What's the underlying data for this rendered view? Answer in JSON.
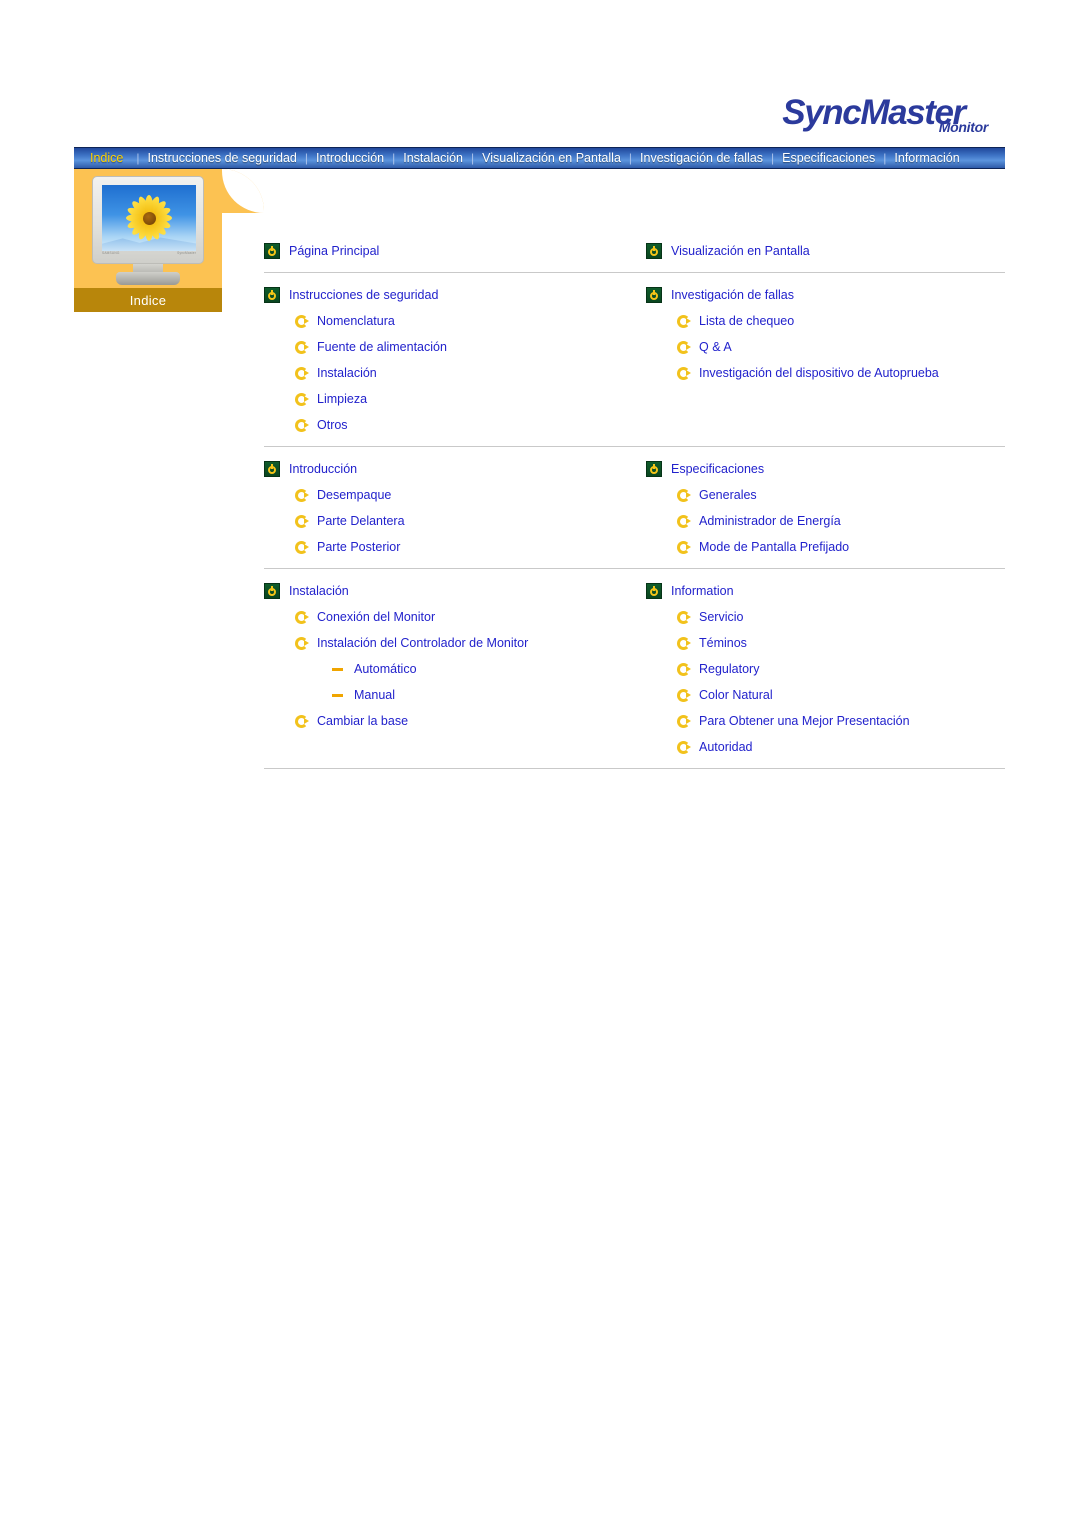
{
  "brand": {
    "name": "SyncMaster",
    "sub": "Monitor"
  },
  "nav": {
    "items": [
      {
        "label": "Indice",
        "active": true
      },
      {
        "label": "Instrucciones de seguridad",
        "active": false
      },
      {
        "label": "Introducción",
        "active": false
      },
      {
        "label": "Instalación",
        "active": false
      },
      {
        "label": "Visualización en Pantalla",
        "active": false
      },
      {
        "label": "Investigación de fallas",
        "active": false
      },
      {
        "label": "Especificaciones",
        "active": false
      },
      {
        "label": "Información",
        "active": false
      }
    ],
    "separator": "|"
  },
  "sidebar": {
    "label": "Indice",
    "image": {
      "icon": "monitor-sunflower-image",
      "brand_mark": "SAMSUNG",
      "model_mark": "SyncMaster"
    }
  },
  "content": {
    "groups": [
      {
        "left": {
          "items": [
            {
              "label": "Página Principal",
              "level": 1,
              "icon": "power-icon"
            }
          ]
        },
        "right": {
          "items": [
            {
              "label": "Visualización en Pantalla",
              "level": 1,
              "icon": "power-icon"
            }
          ]
        }
      },
      {
        "left": {
          "items": [
            {
              "label": "Instrucciones de seguridad",
              "level": 1,
              "icon": "power-icon"
            },
            {
              "label": "Nomenclatura",
              "level": 2,
              "icon": "circle-arrow-icon"
            },
            {
              "label": "Fuente de alimentación",
              "level": 2,
              "icon": "circle-arrow-icon"
            },
            {
              "label": "Instalación",
              "level": 2,
              "icon": "circle-arrow-icon"
            },
            {
              "label": "Limpieza",
              "level": 2,
              "icon": "circle-arrow-icon"
            },
            {
              "label": "Otros",
              "level": 2,
              "icon": "circle-arrow-icon"
            }
          ]
        },
        "right": {
          "items": [
            {
              "label": "Investigación de fallas",
              "level": 1,
              "icon": "power-icon"
            },
            {
              "label": "Lista de chequeo",
              "level": 2,
              "icon": "circle-arrow-icon"
            },
            {
              "label": "Q & A",
              "level": 2,
              "icon": "circle-arrow-icon"
            },
            {
              "label": "Investigación del dispositivo de Autoprueba",
              "level": 2,
              "icon": "circle-arrow-icon"
            }
          ]
        }
      },
      {
        "left": {
          "items": [
            {
              "label": "Introducción",
              "level": 1,
              "icon": "power-icon"
            },
            {
              "label": "Desempaque",
              "level": 2,
              "icon": "circle-arrow-icon"
            },
            {
              "label": "Parte Delantera",
              "level": 2,
              "icon": "circle-arrow-icon"
            },
            {
              "label": "Parte Posterior",
              "level": 2,
              "icon": "circle-arrow-icon"
            }
          ]
        },
        "right": {
          "items": [
            {
              "label": "Especificaciones",
              "level": 1,
              "icon": "power-icon"
            },
            {
              "label": "Generales",
              "level": 2,
              "icon": "circle-arrow-icon"
            },
            {
              "label": "Administrador de Energía",
              "level": 2,
              "icon": "circle-arrow-icon"
            },
            {
              "label": "Mode de Pantalla Prefijado",
              "level": 2,
              "icon": "circle-arrow-icon"
            }
          ]
        }
      },
      {
        "left": {
          "items": [
            {
              "label": "Instalación",
              "level": 1,
              "icon": "power-icon"
            },
            {
              "label": "Conexión del Monitor",
              "level": 2,
              "icon": "circle-arrow-icon"
            },
            {
              "label": "Instalación del Controlador de Monitor",
              "level": 2,
              "icon": "circle-arrow-icon"
            },
            {
              "label": "Automático",
              "level": 3,
              "icon": "dash-icon"
            },
            {
              "label": "Manual",
              "level": 3,
              "icon": "dash-icon"
            },
            {
              "label": "Cambiar la base",
              "level": 2,
              "icon": "circle-arrow-icon"
            }
          ]
        },
        "right": {
          "items": [
            {
              "label": "Information",
              "level": 1,
              "icon": "power-icon"
            },
            {
              "label": "Servicio",
              "level": 2,
              "icon": "circle-arrow-icon"
            },
            {
              "label": "Téminos",
              "level": 2,
              "icon": "circle-arrow-icon"
            },
            {
              "label": "Regulatory",
              "level": 2,
              "icon": "circle-arrow-icon"
            },
            {
              "label": "Color Natural",
              "level": 2,
              "icon": "circle-arrow-icon"
            },
            {
              "label": "Para Obtener una Mejor Presentación",
              "level": 2,
              "icon": "circle-arrow-icon"
            },
            {
              "label": "Autoridad",
              "level": 2,
              "icon": "circle-arrow-icon"
            }
          ]
        }
      }
    ]
  },
  "colors": {
    "link": "#2222cc",
    "nav_active": "#ffd200",
    "panel": "#fcc252",
    "panel_label_bg": "#b8860b",
    "brand": "#2b3a9c",
    "icon_green": "#0f5c2b",
    "icon_gold": "#f2c21c"
  }
}
